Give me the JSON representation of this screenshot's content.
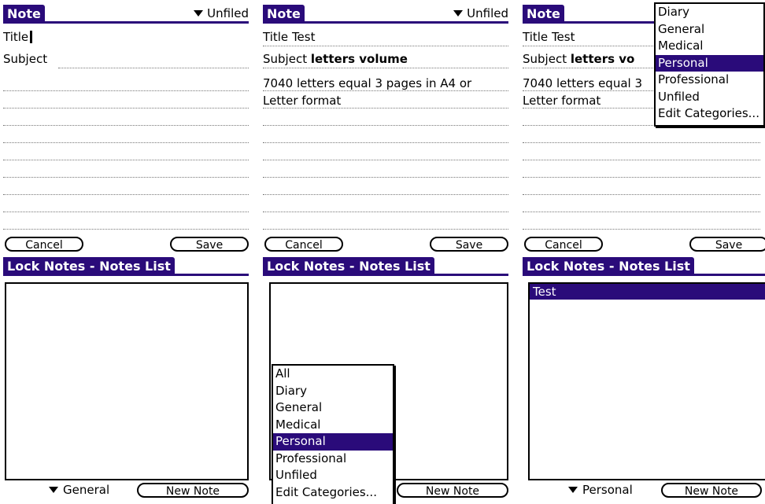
{
  "edit_screens": [
    {
      "tab_label": "Note",
      "category": "Unfiled",
      "title_label": "Title",
      "title_value": "",
      "subject_label": "Subject",
      "subject_value": "",
      "body_lines": [],
      "cancel_label": "Cancel",
      "save_label": "Save"
    },
    {
      "tab_label": "Note",
      "category": "Unfiled",
      "title_label": "Title",
      "title_value": "Test",
      "subject_label": "Subject",
      "subject_value": "letters volume",
      "body_lines": [
        "7040 letters equal 3 pages in A4 or",
        "Letter format"
      ],
      "cancel_label": "Cancel",
      "save_label": "Save"
    },
    {
      "tab_label": "Note",
      "category": "Unfiled",
      "title_label": "Title",
      "title_value": "Test",
      "subject_label": "Subject",
      "subject_value": "letters vo",
      "body_lines": [
        "7040 letters equal 3",
        "Letter format"
      ],
      "cancel_label": "Cancel",
      "save_label": "Save"
    }
  ],
  "category_popup_top": {
    "options": [
      "Diary",
      "General",
      "Medical",
      "Personal",
      "Professional",
      "Unfiled",
      "Edit Categories..."
    ],
    "selected": "Personal"
  },
  "list_screens": [
    {
      "tab_label": "Lock Notes - Notes List",
      "category": "General",
      "new_note_label": "New Note",
      "rows": []
    },
    {
      "tab_label": "Lock Notes - Notes List",
      "category": "",
      "new_note_label": "New Note",
      "rows": []
    },
    {
      "tab_label": "Lock Notes - Notes List",
      "category": "Personal",
      "new_note_label": "New Note",
      "rows": [
        "Test"
      ]
    }
  ],
  "category_popup_bottom": {
    "options": [
      "All",
      "Diary",
      "General",
      "Medical",
      "Personal",
      "Professional",
      "Unfiled",
      "Edit Categories..."
    ],
    "selected": "Personal"
  },
  "colors": {
    "accent": "#2a0b7a"
  },
  "icons": {
    "category_trigger": "triangle-down-icon"
  }
}
